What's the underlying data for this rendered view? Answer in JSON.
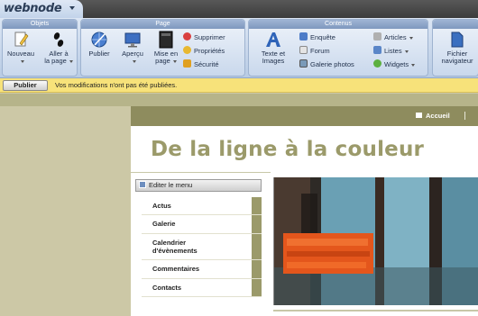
{
  "app": {
    "logo": "webnode"
  },
  "ribbon": {
    "groups": [
      {
        "title": "Objets"
      },
      {
        "title": "Page"
      },
      {
        "title": "Contenus"
      }
    ],
    "objets": {
      "nouveau": "Nouveau",
      "aller_line1": "Aller à",
      "aller_line2": "la page"
    },
    "page": {
      "publier": "Publier",
      "apercu": "Aperçu",
      "mise_line1": "Mise en",
      "mise_line2": "page",
      "supprimer": "Supprimer",
      "proprietes": "Propriétés",
      "securite": "Sécurité"
    },
    "contenus": {
      "texte_line1": "Texte et",
      "texte_line2": "Images",
      "enquete": "Enquête",
      "forum": "Forum",
      "galerie_photos": "Galerie photos",
      "articles": "Articles",
      "listes": "Listes",
      "widgets": "Widgets"
    },
    "fichier": {
      "line1": "Fichier",
      "line2": "navigateur"
    }
  },
  "notice": {
    "publish_label": "Publier",
    "message": "Vos modifications n'ont pas été publiées."
  },
  "site": {
    "home_link": "Accueil",
    "title": "De la ligne à la couleur",
    "edit_menu_label": "Editer le menu",
    "menu_items": [
      {
        "label_line1": "Actus",
        "label_line2": ""
      },
      {
        "label_line1": "Galerie",
        "label_line2": ""
      },
      {
        "label_line1": "Calendrier",
        "label_line2": "d'évènements"
      },
      {
        "label_line1": "Commentaires",
        "label_line2": ""
      },
      {
        "label_line1": "Contacts",
        "label_line2": ""
      }
    ]
  },
  "colors": {
    "olive": "#9b9a6a",
    "notice_yellow": "#f7e27a",
    "ribbon_blue": "#c9d8ec"
  }
}
